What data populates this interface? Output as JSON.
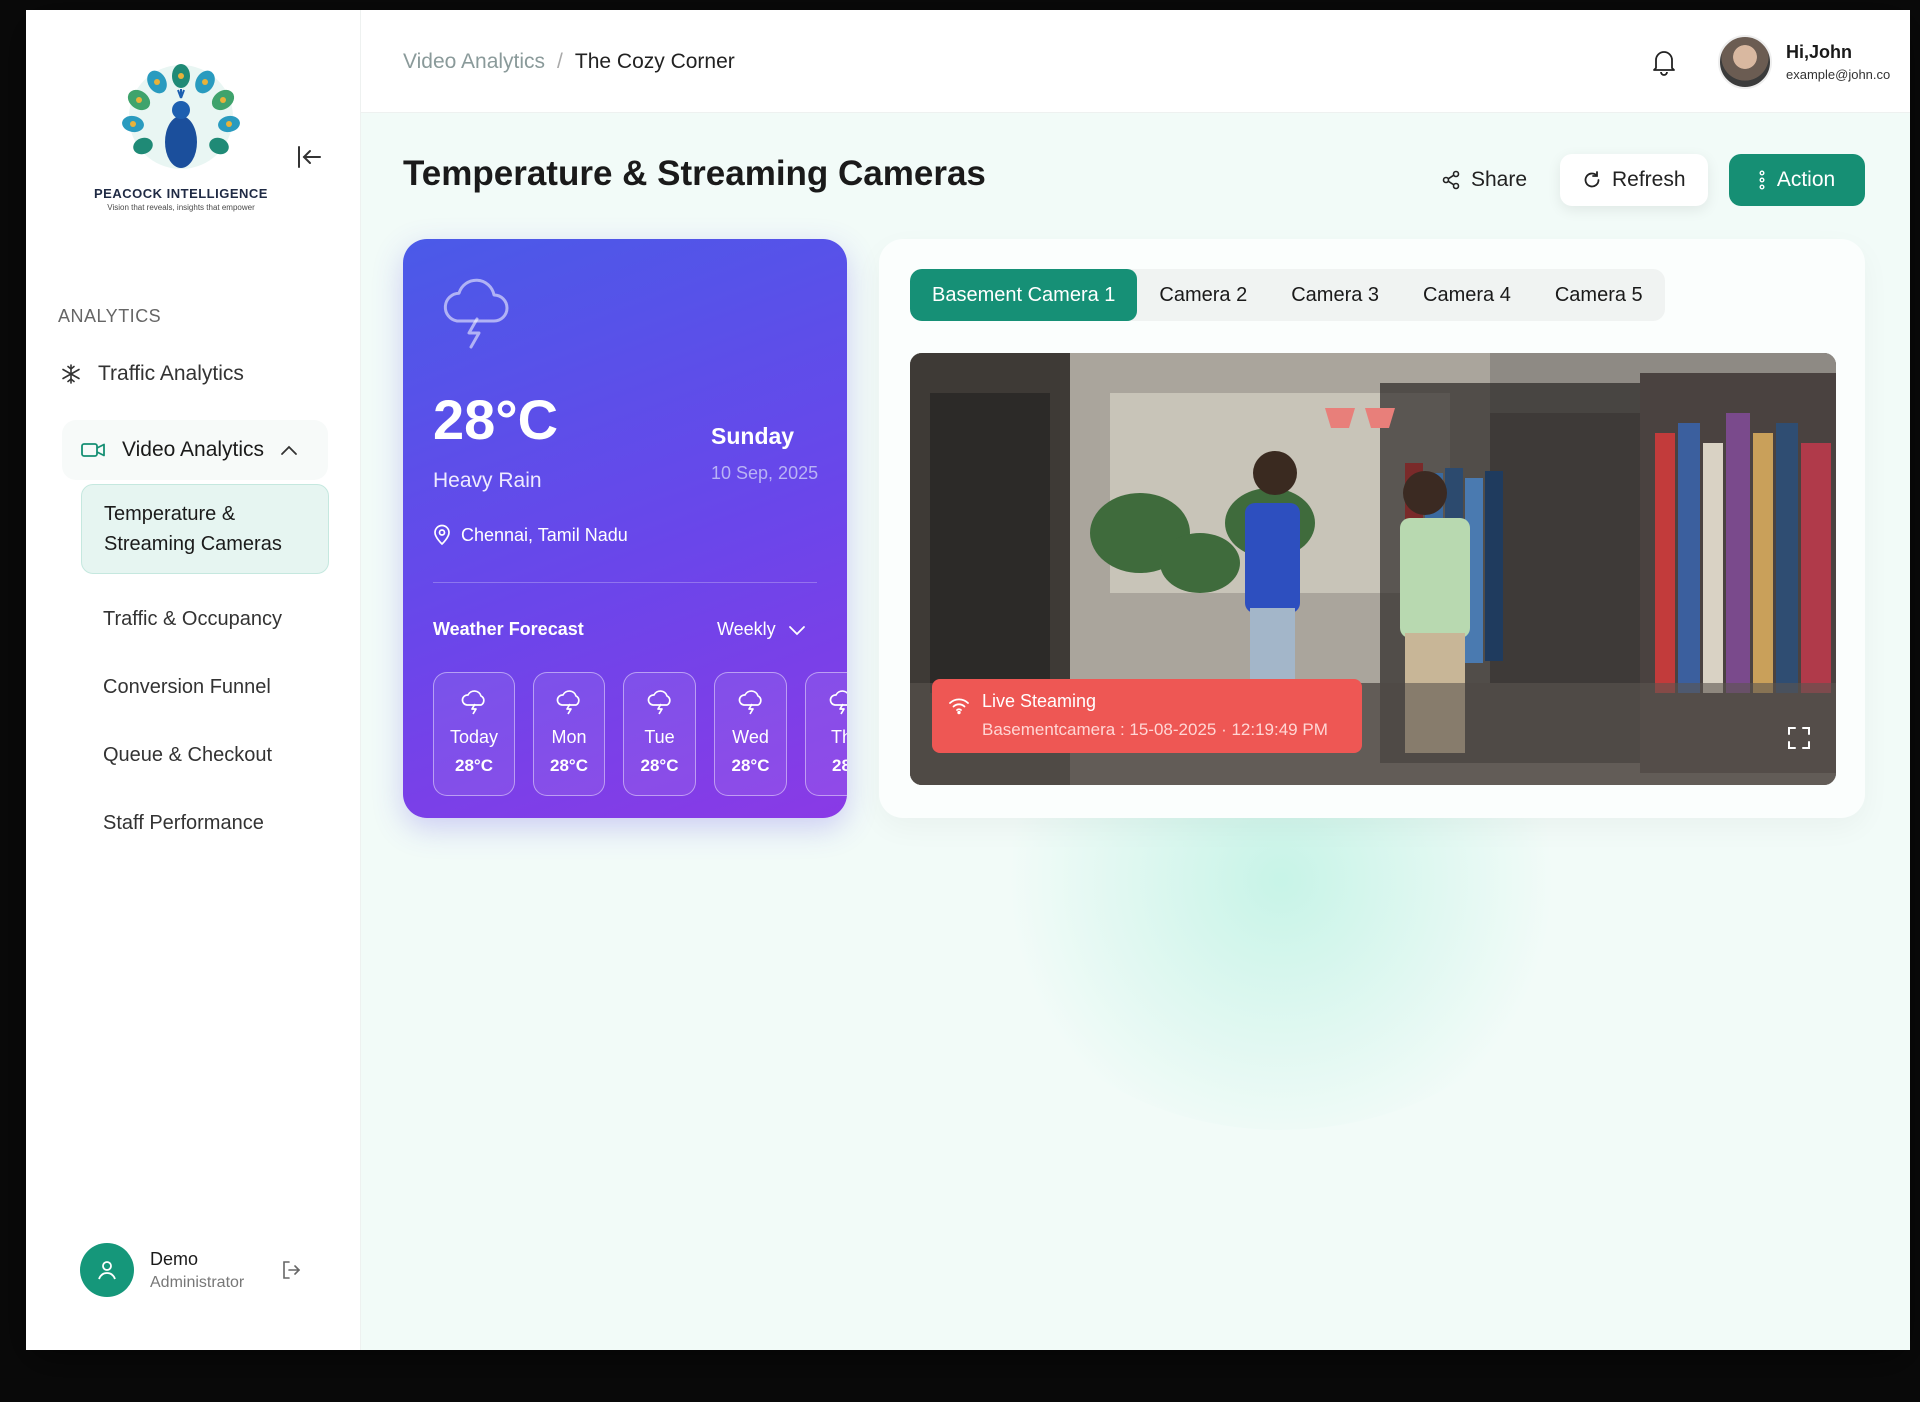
{
  "brand": {
    "name": "PEACOCK INTELLIGENCE",
    "tagline": "Vision that reveals, insights that empower"
  },
  "sidebar": {
    "section_label": "ANALYTICS",
    "items": [
      {
        "label": "Traffic Analytics",
        "icon": "snowflake-icon"
      },
      {
        "label": "Video Analytics",
        "icon": "video-camera-icon",
        "expanded": true
      }
    ],
    "sub_items": [
      {
        "label": "Temperature & Streaming Cameras",
        "active": true
      },
      {
        "label": "Traffic & Occupancy"
      },
      {
        "label": "Conversion Funnel"
      },
      {
        "label": "Queue & Checkout"
      },
      {
        "label": "Staff Performance"
      }
    ],
    "user": {
      "name": "Demo",
      "role": "Administrator"
    }
  },
  "header": {
    "breadcrumb": {
      "parent": "Video Analytics",
      "separator": "/",
      "current": "The Cozy Corner"
    },
    "profile": {
      "greeting": "Hi,John",
      "email": "example@john.co"
    }
  },
  "page": {
    "title": "Temperature & Streaming Cameras",
    "share_label": "Share",
    "refresh_label": "Refresh",
    "action_label": "Action"
  },
  "weather": {
    "temperature": "28°C",
    "condition": "Heavy Rain",
    "day": "Sunday",
    "date": "10 Sep, 2025",
    "location": "Chennai, Tamil Nadu",
    "forecast_title": "Weather Forecast",
    "forecast_range": "Weekly",
    "forecast": [
      {
        "day": "Today",
        "temp": "28°C"
      },
      {
        "day": "Mon",
        "temp": "28°C"
      },
      {
        "day": "Tue",
        "temp": "28°C"
      },
      {
        "day": "Wed",
        "temp": "28°C"
      },
      {
        "day": "Th",
        "temp": "28"
      }
    ]
  },
  "cameras": {
    "tabs": [
      "Basement Camera 1",
      "Camera 2",
      "Camera 3",
      "Camera 4",
      "Camera 5"
    ],
    "active_tab": 0,
    "live": {
      "title": "Live Steaming",
      "meta": "Basementcamera : 15-08-2025 · 12:19:49 PM"
    }
  },
  "colors": {
    "accent": "#168f74",
    "live_badge": "#ee5754",
    "weather_start": "#4a5ae8",
    "weather_end": "#8a3ae6"
  }
}
